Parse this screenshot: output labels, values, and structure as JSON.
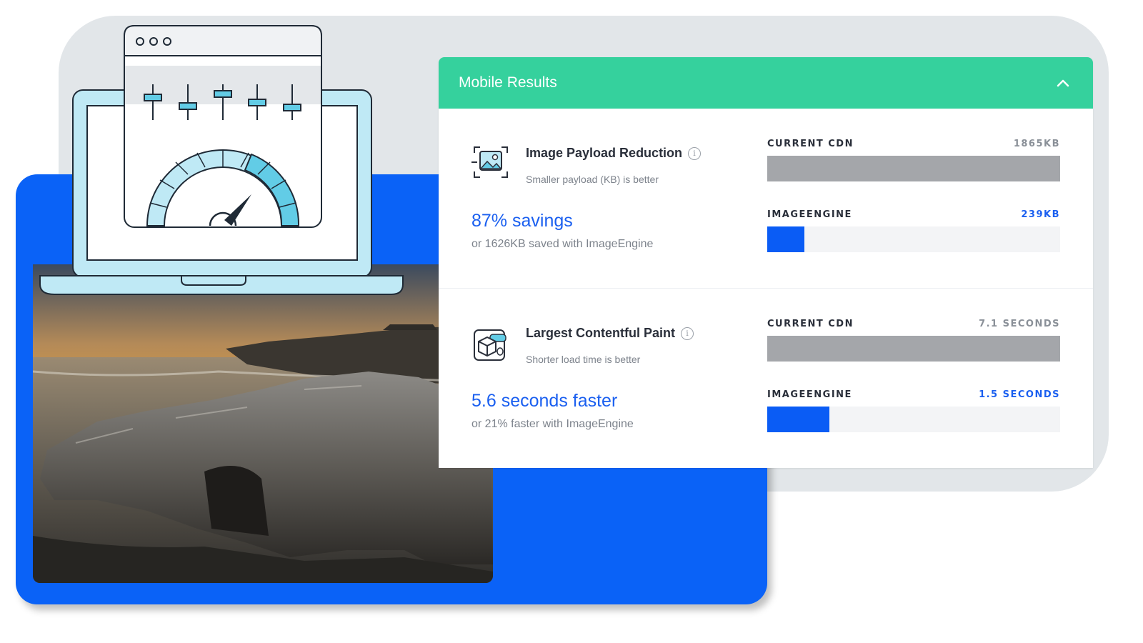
{
  "colors": {
    "header_green": "#35d19d",
    "brand_blue": "#0a62f7",
    "accent_blue": "#1a5ff0",
    "current_bar_gray": "#a4a6aa",
    "background_gray": "#e2e6e9"
  },
  "results": {
    "title": "Mobile Results",
    "collapse_icon": "chevron-up-icon",
    "metrics": [
      {
        "icon": "image-frame-icon",
        "title": "Image Payload Reduction",
        "info_glyph": "i",
        "subtitle": "Smaller payload (KB) is better",
        "headline": "87% savings",
        "detail": "or 1626KB saved with ImageEngine",
        "bars": [
          {
            "label": "CURRENT CDN",
            "value_text": "1865KB",
            "fill_fraction": 1.0,
            "style": "gray"
          },
          {
            "label": "IMAGEENGINE",
            "value_text": "239KB",
            "fill_fraction": 0.128,
            "style": "blue"
          }
        ]
      },
      {
        "icon": "package-icon",
        "title": "Largest Contentful Paint",
        "info_glyph": "i",
        "subtitle": "Shorter load time is better",
        "headline": "5.6 seconds faster",
        "detail": "or 21% faster with ImageEngine",
        "bars": [
          {
            "label": "CURRENT CDN",
            "value_text": "7.1 SECONDS",
            "fill_fraction": 1.0,
            "style": "gray"
          },
          {
            "label": "IMAGEENGINE",
            "value_text": "1.5 SECONDS",
            "fill_fraction": 0.213,
            "style": "blue"
          }
        ]
      }
    ]
  },
  "illustration": {
    "laptop_icon": "laptop-icon",
    "window_dots_icon": "window-dots-icon",
    "sliders_icon": "sliders-icon",
    "gauge_icon": "speed-gauge-icon",
    "photo": "coastal-rock-sunset-photo"
  }
}
